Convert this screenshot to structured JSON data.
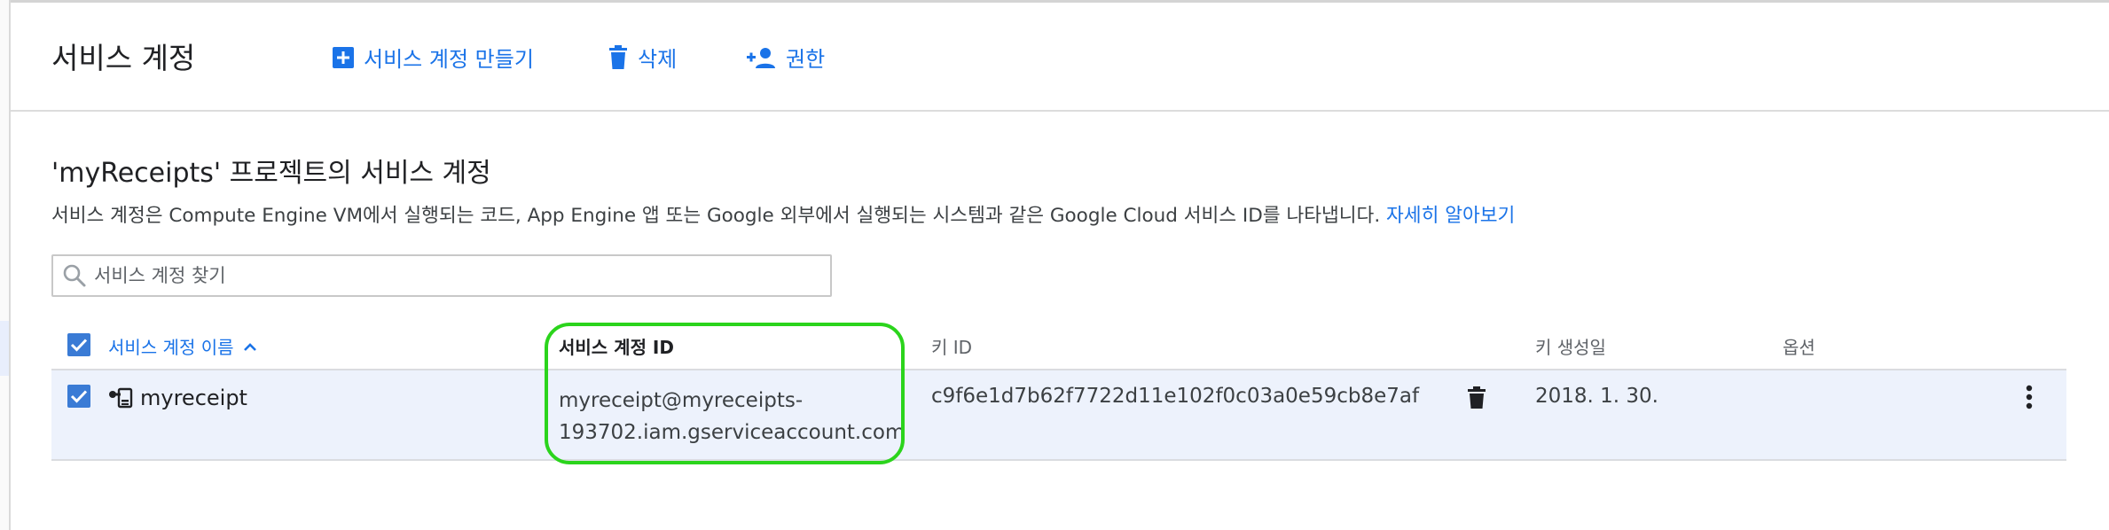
{
  "header": {
    "title": "서비스 계정",
    "actions": {
      "create": "서비스 계정 만들기",
      "delete": "삭제",
      "permissions": "권한"
    }
  },
  "section": {
    "title": "'myReceipts' 프로젝트의 서비스 계정",
    "description": "서비스 계정은 Compute Engine VM에서 실행되는 코드, App Engine 앱 또는 Google 외부에서 실행되는 시스템과 같은 Google Cloud 서비스 ID를 나타냅니다.",
    "learn_more": "자세히 알아보기"
  },
  "search": {
    "placeholder": "서비스 계정 찾기"
  },
  "table": {
    "columns": {
      "name": "서비스 계정 이름",
      "account_id": "서비스 계정 ID",
      "key_id": "키 ID",
      "key_created": "키 생성일",
      "options": "옵션"
    },
    "rows": [
      {
        "selected": true,
        "name": "myreceipt",
        "account_id_line1": "myreceipt@myreceipts-",
        "account_id_line2": "193702.iam.gserviceaccount.com",
        "key_id": "c9f6e1d7b62f7722d11e102f0c03a0e59cb8e7af",
        "key_created": "2018. 1. 30."
      }
    ]
  },
  "colors": {
    "accent": "#1a73e8",
    "checkbox": "#3a7bd5",
    "row_selected": "#edf2fc",
    "highlight_ring": "#2bd41c"
  }
}
